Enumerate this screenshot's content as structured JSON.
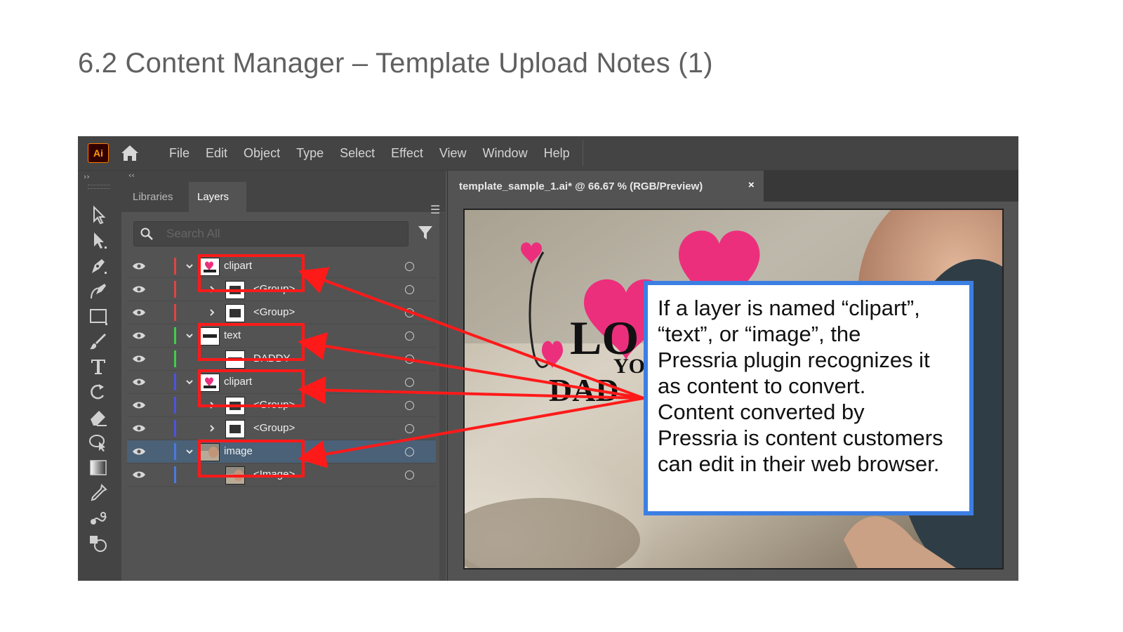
{
  "slide": {
    "title": "6.2 Content Manager – Template Upload Notes (1)"
  },
  "app": {
    "logo": "Ai",
    "menu": [
      "File",
      "Edit",
      "Object",
      "Type",
      "Select",
      "Effect",
      "View",
      "Window",
      "Help"
    ],
    "toolbar_collapse": "››",
    "tools": [
      "selection-tool-icon",
      "direct-selection-tool-icon",
      "pen-tool-icon",
      "curvature-tool-icon",
      "rectangle-tool-icon",
      "paintbrush-tool-icon",
      "type-tool-icon",
      "rotate-tool-icon",
      "eraser-tool-icon",
      "puppet-warp-tool-icon",
      "gradient-tool-icon",
      "eyedropper-tool-icon",
      "blend-tool-icon",
      "shape-builder-tool-icon"
    ]
  },
  "panel": {
    "collapse": "‹‹",
    "tabs": [
      "Libraries",
      "Layers"
    ],
    "search_placeholder": "Search All",
    "layers": [
      {
        "name": "clipart",
        "level": 0,
        "color": "#e04444",
        "expanded": true,
        "selected": false
      },
      {
        "name": "<Group>",
        "level": 1,
        "color": "#e04444",
        "expanded": false,
        "selected": false
      },
      {
        "name": "<Group>",
        "level": 1,
        "color": "#e04444",
        "expanded": false,
        "selected": false
      },
      {
        "name": "text",
        "level": 0,
        "color": "#3fce4a",
        "expanded": true,
        "selected": false
      },
      {
        "name": "DADDY",
        "level": 1,
        "color": "#3fce4a",
        "expanded": false,
        "selected": false
      },
      {
        "name": "clipart",
        "level": 0,
        "color": "#4a55e0",
        "expanded": true,
        "selected": false
      },
      {
        "name": "<Group>",
        "level": 1,
        "color": "#4a55e0",
        "expanded": false,
        "selected": false
      },
      {
        "name": "<Group>",
        "level": 1,
        "color": "#4a55e0",
        "expanded": false,
        "selected": false
      },
      {
        "name": "image",
        "level": 0,
        "color": "#4a7ae0",
        "expanded": true,
        "selected": true
      },
      {
        "name": "<Image>",
        "level": 1,
        "color": "#4a7ae0",
        "expanded": false,
        "selected": false
      }
    ]
  },
  "document": {
    "tab_title": "template_sample_1.ai* @ 66.67 % (RGB/Preview)",
    "close": "×",
    "artwork_text_love": "LO",
    "artwork_text_you": "YO",
    "artwork_text_daddy": "DAD"
  },
  "callout": {
    "lines": [
      "If a layer is named “clipart”,",
      "“text”, or “image”, the",
      "Pressria plugin recognizes it",
      "as content to convert.",
      "Content converted by",
      "Pressria is content customers",
      "can edit in their web browser."
    ]
  },
  "colors": {
    "annotation_red": "#ff1a1a",
    "callout_border": "#3c7fe3",
    "ai_orange": "#ff9a00",
    "heart_pink": "#ec2f7c"
  }
}
